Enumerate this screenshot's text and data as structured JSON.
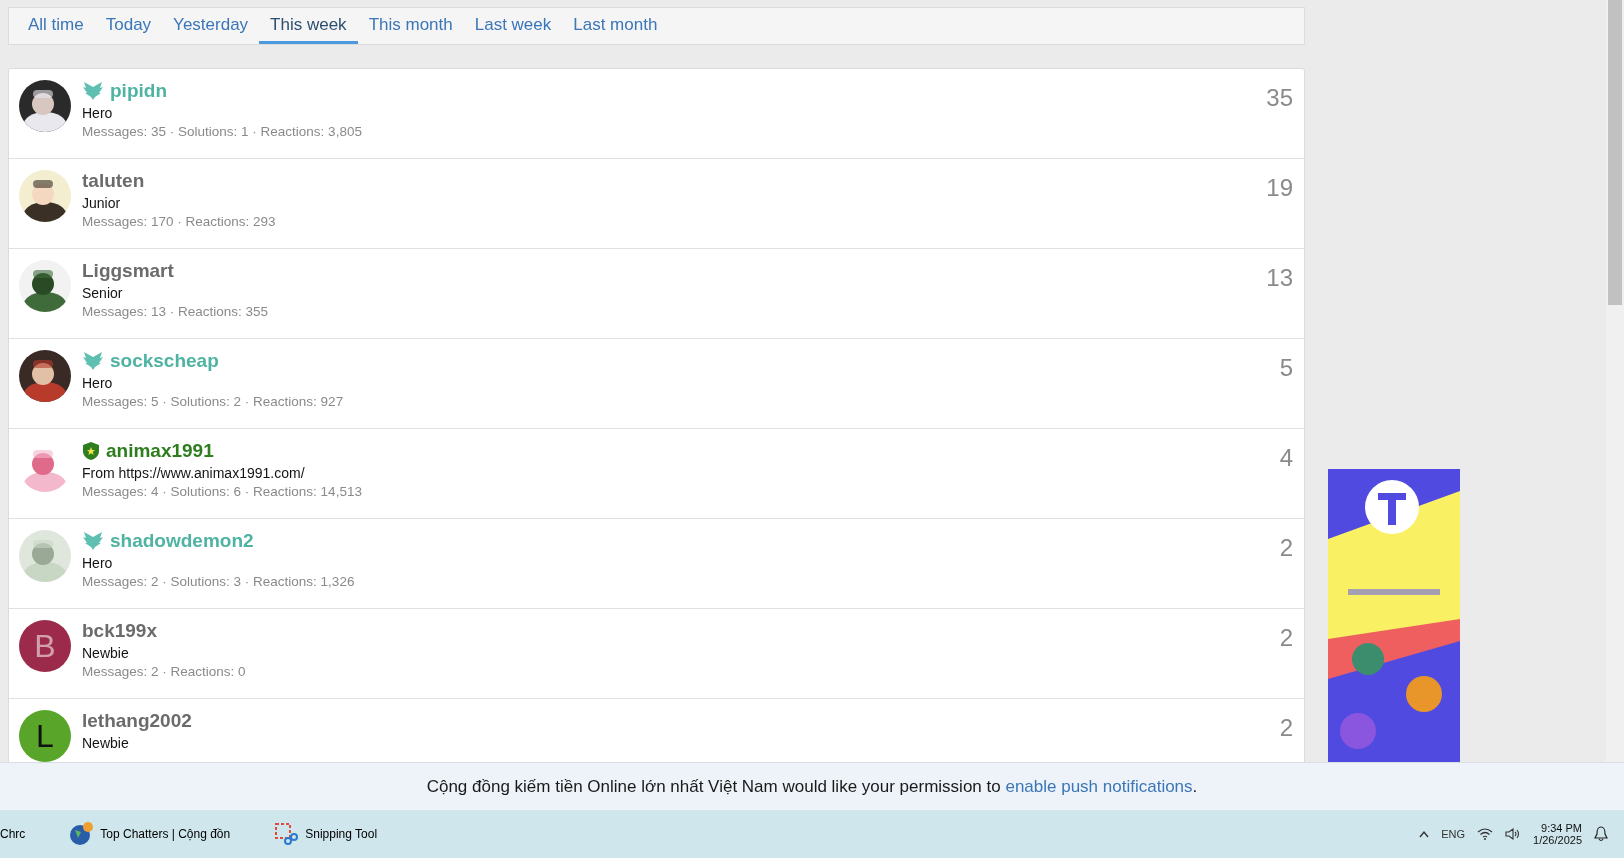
{
  "tabs": [
    {
      "label": "All time",
      "selected": false
    },
    {
      "label": "Today",
      "selected": false
    },
    {
      "label": "Yesterday",
      "selected": false
    },
    {
      "label": "This week",
      "selected": true
    },
    {
      "label": "This month",
      "selected": false
    },
    {
      "label": "Last week",
      "selected": false
    },
    {
      "label": "Last month",
      "selected": false
    }
  ],
  "members": [
    {
      "name": "pipidn",
      "color": "#4fb3a2",
      "badge": {
        "kind": "wings"
      },
      "title": "Hero",
      "stats": "Messages: 35 · Solutions: 1 · Reactions: 3,805",
      "count": "35"
    },
    {
      "name": "taluten",
      "color": "#6b6b6b",
      "title": "Junior",
      "stats": "Messages: 170 · Reactions: 293",
      "count": "19"
    },
    {
      "name": "Liggsmart",
      "color": "#6b6b6b",
      "title": "Senior",
      "stats": "Messages: 13 · Reactions: 355",
      "count": "13"
    },
    {
      "name": "sockscheap",
      "color": "#4fb3a2",
      "badge": {
        "kind": "wings"
      },
      "title": "Hero",
      "stats": "Messages: 5 · Solutions: 2 · Reactions: 927",
      "count": "5"
    },
    {
      "name": "animax1991",
      "color": "#2e7d1f",
      "badge": {
        "kind": "shield"
      },
      "title": "From https://www.animax1991.com/",
      "stats": "Messages: 4 · Solutions: 6 · Reactions: 14,513",
      "count": "4"
    },
    {
      "name": "shadowdemon2",
      "color": "#4fb3a2",
      "badge": {
        "kind": "wings"
      },
      "title": "Hero",
      "stats": "Messages: 2 · Solutions: 3 · Reactions: 1,326",
      "count": "2"
    },
    {
      "name": "bck199x",
      "color": "#6b6b6b",
      "avatar": {
        "kind": "letter",
        "letter": "B",
        "color": "#9c2a4a"
      },
      "title": "Newbie",
      "stats": "Messages: 2 · Reactions: 0",
      "count": "2"
    },
    {
      "name": "lethang2002",
      "color": "#6b6b6b",
      "avatar": {
        "kind": "letter",
        "letter": "L",
        "color": "#58a52a"
      },
      "title": "Newbie",
      "count": "2"
    }
  ],
  "notification": {
    "text": "Cộng đồng kiếm tiền Online lớn nhất Việt Nam would like your permission to ",
    "link": "enable push notifications",
    "end": "."
  },
  "taskbar": {
    "apps": [
      {
        "label": "Chrc",
        "kind": "cut"
      },
      {
        "label": "Top Chatters | Cộng đồn",
        "kind": "site"
      },
      {
        "label": "Snipping Tool",
        "kind": "snip"
      }
    ],
    "tray": {
      "input": "ENG",
      "time": "9:34 PM",
      "date": "1/26/2025"
    }
  }
}
